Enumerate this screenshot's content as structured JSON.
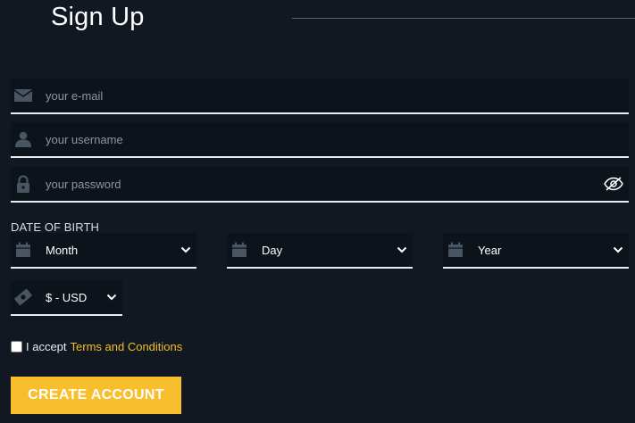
{
  "header": {
    "title": "Sign Up"
  },
  "form": {
    "email": {
      "placeholder": "your e-mail",
      "value": "",
      "icon": "envelope-icon"
    },
    "username": {
      "placeholder": "your username",
      "value": "",
      "icon": "user-icon"
    },
    "password": {
      "placeholder": "your password",
      "value": "",
      "icon": "lock-icon",
      "toggle_icon": "eye-slash-icon"
    },
    "dob": {
      "label": "DATE OF BIRTH",
      "month": {
        "selected": "Month",
        "icon": "calendar-icon"
      },
      "day": {
        "selected": "Day",
        "icon": "calendar-icon"
      },
      "year": {
        "selected": "Year",
        "icon": "calendar-icon"
      }
    },
    "currency": {
      "selected": "$ - USD",
      "icon": "money-icon"
    },
    "terms": {
      "prefix": "I accept",
      "link": "Terms and Conditions",
      "checked": false
    },
    "submit_label": "CREATE ACCOUNT"
  },
  "colors": {
    "background": "#111821",
    "field_background": "#0c131b",
    "icon": "#4a5562",
    "accent": "#f9be2b",
    "link": "#f5bf26",
    "underline": "#e9edf2"
  }
}
